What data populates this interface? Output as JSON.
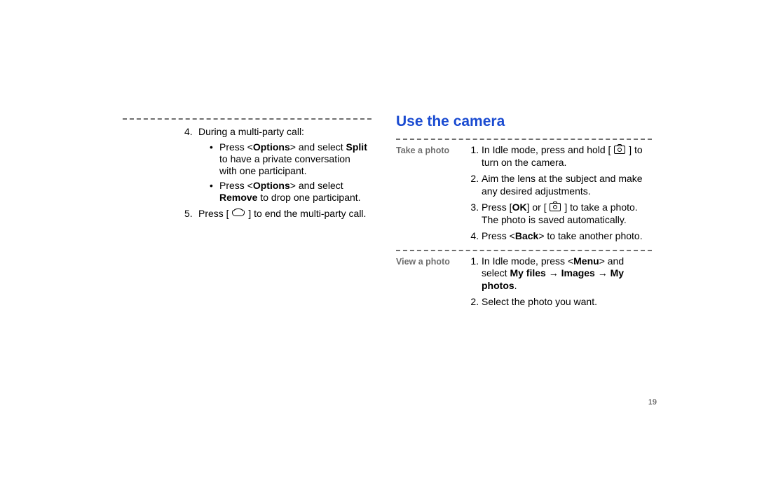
{
  "left": {
    "item4_intro": "During a multi-party call:",
    "sub_a_before": "Press <",
    "sub_a_opt": "Options",
    "sub_a_mid": "> and select ",
    "sub_a_split": "Split",
    "sub_a_after": " to have a private conversation with one participant.",
    "sub_b_before": "Press <",
    "sub_b_opt": "Options",
    "sub_b_mid": "> and select ",
    "sub_b_remove": "Remove",
    "sub_b_after": " to drop one participant.",
    "item5_before": "Press [ ",
    "item5_after": " ] to end the multi-party call."
  },
  "right": {
    "heading": "Use the camera",
    "take_label": "Take a photo",
    "take1_before": "In Idle mode, press and hold [ ",
    "take1_after": " ] to turn on the camera.",
    "take2": "Aim the lens at the subject and make any desired adjustments.",
    "take3_before": "Press [",
    "take3_ok": "OK",
    "take3_mid": "] or [ ",
    "take3_after": " ] to take a photo. The photo is saved automatically.",
    "take4_before": "Press <",
    "take4_back": "Back",
    "take4_after": "> to take another photo.",
    "view_label": "View a photo",
    "view1_before": "In Idle mode, press <",
    "view1_menu": "Menu",
    "view1_mid": "> and select ",
    "view1_path": "My files → Images → My photos",
    "view1_after": ".",
    "view2": "Select the photo you want."
  },
  "page_number": "19"
}
